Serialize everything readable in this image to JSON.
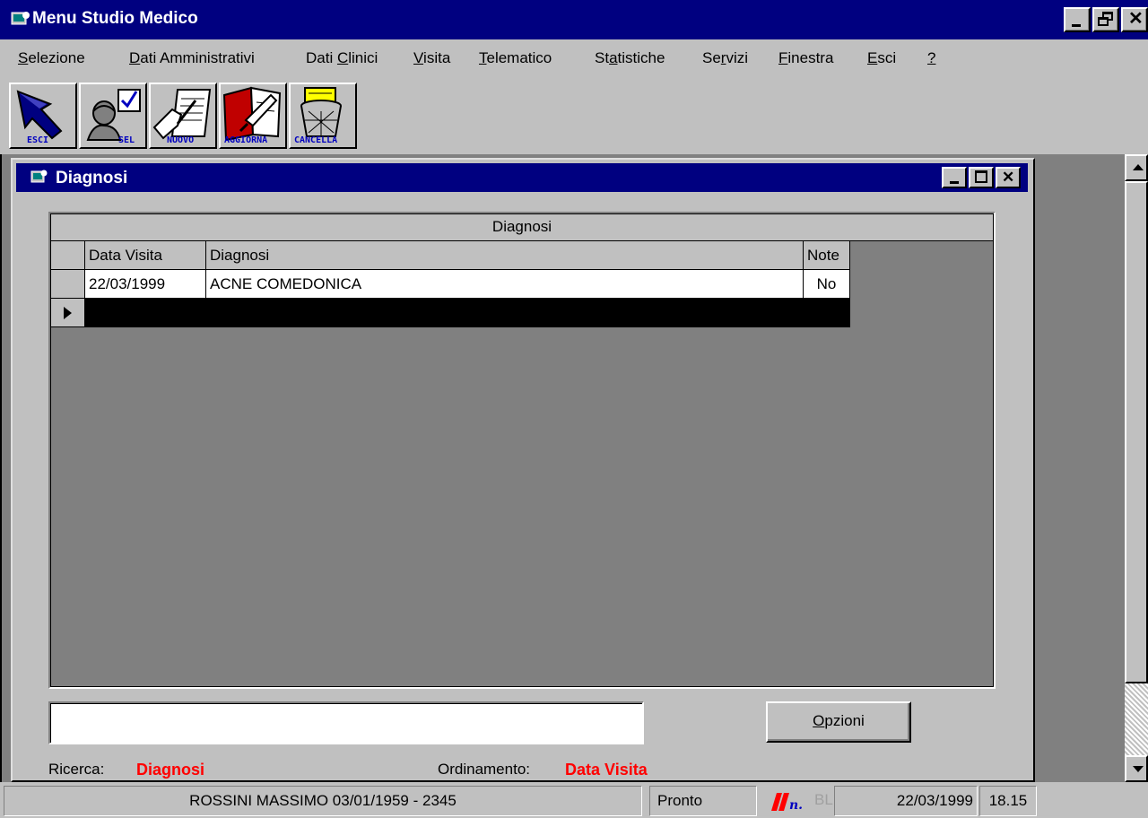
{
  "app": {
    "title": "Menu Studio Medico"
  },
  "menu": [
    {
      "label": "Selezione",
      "u": "S"
    },
    {
      "label": "Dati Amministrativi",
      "u": "D"
    },
    {
      "label": "Dati Clinici",
      "u": "C"
    },
    {
      "label": "Visita",
      "u": "V"
    },
    {
      "label": "Telematico",
      "u": "T"
    },
    {
      "label": "Statistiche",
      "u": "a"
    },
    {
      "label": "Servizi",
      "u": "r"
    },
    {
      "label": "Finestra",
      "u": "F"
    },
    {
      "label": "Esci",
      "u": "E"
    },
    {
      "label": "?",
      "u": "?"
    }
  ],
  "toolbar": {
    "esci": "ESCI",
    "sel": "SEL",
    "nuovo": "NUOVO",
    "aggiorna": "AGGIORNA",
    "cancella": "CANCELLA"
  },
  "child_window": {
    "title": "Diagnosi"
  },
  "grid": {
    "caption": "Diagnosi",
    "columns": [
      "Data Visita",
      "Diagnosi",
      "Note"
    ],
    "rows": [
      {
        "data_visita": "22/03/1999",
        "diagnosi": "ACNE COMEDONICA",
        "note": "No"
      }
    ]
  },
  "search": {
    "value": ""
  },
  "buttons": {
    "opzioni": "Opzioni"
  },
  "footer": {
    "ricerca_label": "Ricerca:",
    "ricerca_value": "Diagnosi",
    "ordinamento_label": "Ordinamento:",
    "ordinamento_value": "Data Visita"
  },
  "status": {
    "patient": "ROSSINI MASSIMO 03/01/1959 - 2345",
    "state": "Pronto",
    "bl": "BL",
    "date": "22/03/1999",
    "time": "18.15"
  },
  "colors": {
    "titlebar": "#000080",
    "face": "#c0c0c0",
    "mdi_bg": "#808080",
    "accent_red": "#ff0000"
  },
  "icons": [
    "app-icon",
    "exit-arrow-icon",
    "select-person-icon",
    "new-writing-icon",
    "update-book-icon",
    "trash-basket-icon",
    "window-icon",
    "logo-icon"
  ]
}
